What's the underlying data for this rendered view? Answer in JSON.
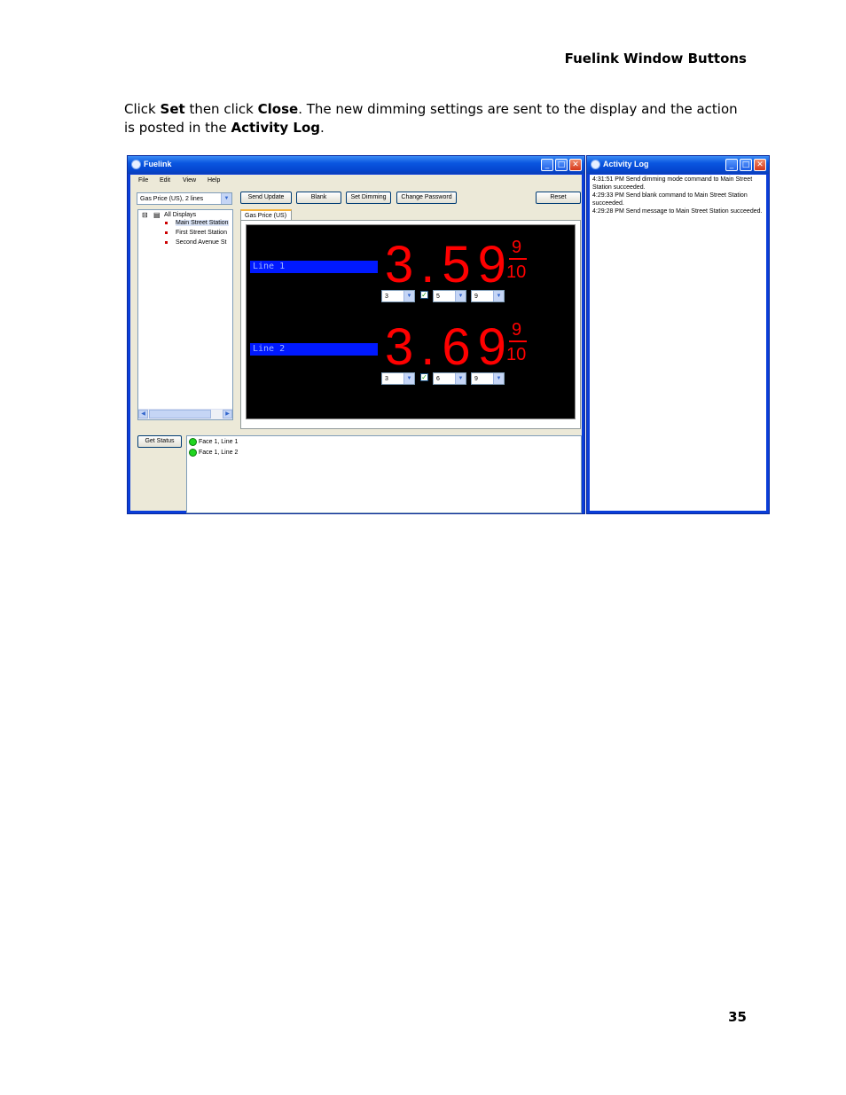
{
  "header": {
    "title": "Fuelink Window Buttons"
  },
  "instruction": {
    "p1": "Click ",
    "set": "Set",
    "p2": " then click ",
    "close": "Close",
    "p3": ". The new dimming settings are sent to the display and the action is posted in the ",
    "log": "Activity Log",
    "p4": "."
  },
  "fuelink": {
    "title": "Fuelink",
    "menu": [
      "File",
      "Edit",
      "View",
      "Help"
    ],
    "dropdown_value": "Gas Price (US), 2 lines",
    "buttons": {
      "send_update": "Send Update",
      "blank": "Blank",
      "set_dimming": "Set Dimming",
      "change_password": "Change Password",
      "reset": "Reset",
      "get_status": "Get Status"
    },
    "tree": {
      "root": "All Displays",
      "items": [
        "Main Street Station",
        "First Street Station",
        "Second Avenue St"
      ]
    },
    "tab": "Gas Price (US)",
    "sign": {
      "line1": {
        "label": "Line 1",
        "price": "3.59",
        "frac_num": "9",
        "frac_den": "10",
        "d1": "3",
        "d2": "5",
        "d3": "9"
      },
      "line2": {
        "label": "Line 2",
        "price": "3.69",
        "frac_num": "9",
        "frac_den": "10",
        "d1": "3",
        "d2": "6",
        "d3": "9"
      }
    },
    "status": [
      "Face 1, Line 1",
      "Face 1, Line 2"
    ],
    "colors": {
      "sign_bg": "#000000",
      "price": "#ff0000",
      "label_bg": "#0019ff",
      "status_ok": "#1fd51f"
    }
  },
  "activity_log": {
    "title": "Activity Log",
    "entries": [
      "4:31:51 PM Send dimming mode command to Main Street Station succeeded.",
      "4:29:33 PM Send blank command to Main Street Station succeeded.",
      "4:29:28 PM Send message to Main Street Station succeeded."
    ]
  },
  "page_number": "35"
}
